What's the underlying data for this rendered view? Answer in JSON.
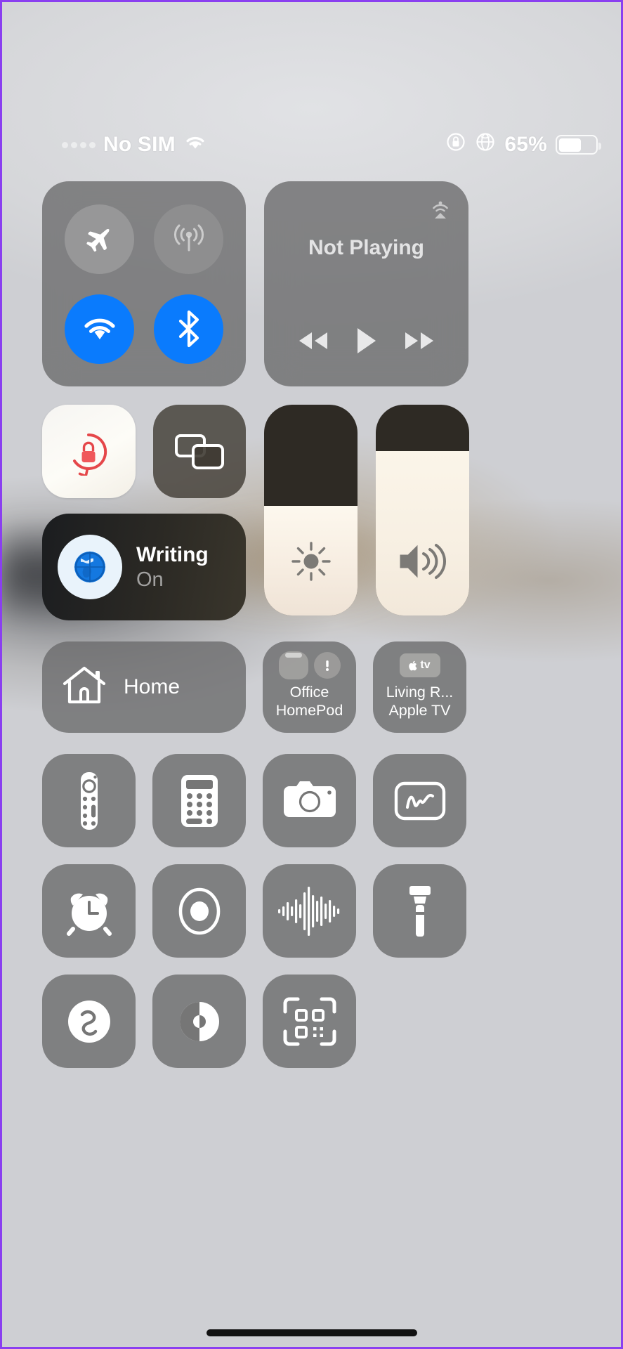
{
  "theme": {
    "accent_blue": "#0a7bfd",
    "module_gray": "#696a6a",
    "rotation_lock_red": "#e5474a",
    "globe_blue": "#1478e0",
    "border_purple": "#8a3ff0"
  },
  "status_bar": {
    "carrier": "No SIM",
    "wifi_icon": "wifi-icon",
    "sim_signal_icon": "signal-dots-icon",
    "rotation_lock_icon": "rotation-lock-icon",
    "vpn_globe_icon": "globe-icon",
    "battery_percent": "65%",
    "battery_level": 65,
    "battery_icon": "battery-icon"
  },
  "connectivity": {
    "name": "connectivity-module",
    "buttons": [
      {
        "name": "airplane-mode",
        "icon": "airplane-icon",
        "state": "off"
      },
      {
        "name": "cellular-data",
        "icon": "cellular-antenna-icon",
        "state": "off-dim"
      },
      {
        "name": "wifi",
        "icon": "wifi-icon",
        "state": "on"
      },
      {
        "name": "bluetooth",
        "icon": "bluetooth-icon",
        "state": "on"
      }
    ]
  },
  "media": {
    "name": "now-playing-module",
    "title": "Not Playing",
    "airplay_icon": "airplay-audio-icon",
    "controls": [
      {
        "name": "rewind-button",
        "icon": "rewind-icon"
      },
      {
        "name": "play-button",
        "icon": "play-icon"
      },
      {
        "name": "fast-forward-button",
        "icon": "fast-forward-icon"
      }
    ]
  },
  "tiles": {
    "rotation_lock": {
      "label": "Rotation Lock",
      "icon": "rotation-lock-icon",
      "state": "on"
    },
    "screen_mirroring": {
      "label": "Screen Mirroring",
      "icon": "screen-mirroring-icon",
      "state": "off"
    },
    "writing": {
      "title": "Writing",
      "state_label": "On",
      "icon": "globe-icon"
    }
  },
  "sliders": {
    "brightness": {
      "label": "Brightness",
      "icon": "brightness-sun-icon",
      "value": 52
    },
    "volume": {
      "label": "Volume",
      "icon": "speaker-waves-icon",
      "value": 78
    }
  },
  "home": {
    "home_tile": {
      "label": "Home",
      "icon": "home-house-icon"
    },
    "devices": [
      {
        "name_line1": "Office",
        "name_line2": "HomePod",
        "icon": "homepod-icon",
        "badge": "warning-icon"
      },
      {
        "name_line1": "Living R...",
        "name_line2": "Apple TV",
        "icon": "apple-tv-icon"
      }
    ]
  },
  "app_grid": [
    {
      "name": "apple-tv-remote",
      "label": "Apple TV Remote",
      "icon": "tv-remote-icon"
    },
    {
      "name": "calculator",
      "label": "Calculator",
      "icon": "calculator-icon"
    },
    {
      "name": "camera",
      "label": "Camera",
      "icon": "camera-icon"
    },
    {
      "name": "quick-note",
      "label": "Quick Note",
      "icon": "note-scribble-icon"
    },
    {
      "name": "timer",
      "label": "Timer",
      "icon": "alarm-clock-icon"
    },
    {
      "name": "screen-recording",
      "label": "Screen Recording",
      "icon": "record-circle-icon"
    },
    {
      "name": "voice-memos",
      "label": "Voice Memos",
      "icon": "waveform-icon"
    },
    {
      "name": "flashlight",
      "label": "Flashlight",
      "icon": "flashlight-icon"
    },
    {
      "name": "music-recognition",
      "label": "Music Recognition",
      "icon": "shazam-icon"
    },
    {
      "name": "dark-mode",
      "label": "Dark Mode",
      "icon": "dark-mode-circle-icon"
    },
    {
      "name": "code-scanner",
      "label": "Code Scanner",
      "icon": "qr-code-icon"
    }
  ],
  "home_indicator": {
    "name": "home-indicator"
  }
}
